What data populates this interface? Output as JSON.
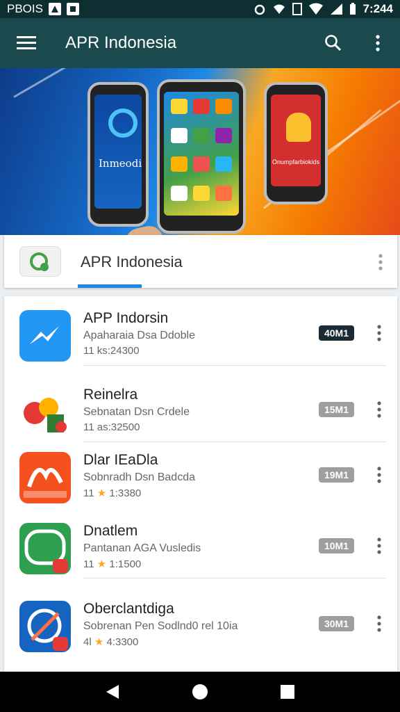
{
  "status_bar": {
    "left_text": "PBOIS",
    "time": "7:244",
    "icons": [
      "alarm-icon",
      "wifi-icon",
      "sim-icon",
      "signal-icon",
      "battery-icon"
    ]
  },
  "toolbar": {
    "title": "APR Indonesia",
    "icons": [
      "menu-icon",
      "search-icon",
      "more-vert-icon"
    ]
  },
  "banner": {
    "phone_left_text": "Inmeodie",
    "phone_right_text": "Onumpfarbiokids"
  },
  "developer": {
    "name": "APR Indonesia"
  },
  "apps": [
    {
      "title": "APP Indorsin",
      "subtitle": "Apaharaia Dsa Ddoble",
      "meta": "11 ks:24300",
      "size": "40M1",
      "icon": "messenger-icon",
      "dark": true,
      "star": false
    },
    {
      "title": "Reinelra",
      "subtitle": "Sebnatan Dsn Crdele",
      "meta": "11 as:32500",
      "size": "15M1",
      "icon": "game-icon",
      "dark": false,
      "star": false
    },
    {
      "title": "Dlar IEaDla",
      "subtitle": "Sobnradh Dsn Badcda",
      "meta": "11 ★ 1:3380",
      "size": "19M1",
      "icon": "brand-icon",
      "dark": false,
      "star": true
    },
    {
      "title": "Dnatlem",
      "subtitle": "Pantanan AGA Vusledis",
      "meta": "11 ★ 1:1500",
      "size": "10M1",
      "icon": "aitc-icon",
      "dark": false,
      "star": true
    },
    {
      "title": "Oberclantdiga",
      "subtitle": "Sobrenan Pen Sodlnd0  rel  10ia",
      "meta": "4l ★ 4:3300",
      "size": "30M1",
      "icon": "tools-icon",
      "dark": false,
      "star": true
    }
  ],
  "colors": {
    "status_bar": "#0e2f31",
    "toolbar": "#1a4a4d",
    "accent": "#1e88e5"
  }
}
